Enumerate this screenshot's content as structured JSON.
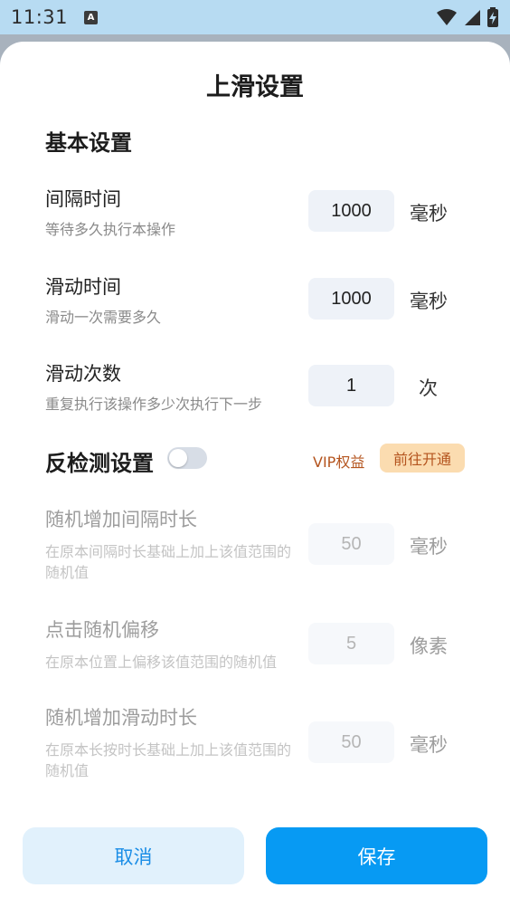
{
  "status_bar": {
    "time": "11:31",
    "notification_icon_letter": "A"
  },
  "sheet": {
    "title": "上滑设置"
  },
  "basic_section": {
    "title": "基本设置",
    "rows": [
      {
        "label": "间隔时间",
        "desc": "等待多久执行本操作",
        "value": "1000",
        "unit": "毫秒"
      },
      {
        "label": "滑动时间",
        "desc": "滑动一次需要多久",
        "value": "1000",
        "unit": "毫秒"
      },
      {
        "label": "滑动次数",
        "desc": "重复执行该操作多少次执行下一步",
        "value": "1",
        "unit": "次"
      }
    ]
  },
  "anti_detect_section": {
    "title": "反检测设置",
    "toggle_on": false,
    "vip_label": "VIP权益",
    "vip_button": "前往开通",
    "rows": [
      {
        "label": "随机增加间隔时长",
        "desc": "在原本间隔时长基础上加上该值范围的随机值",
        "value": "50",
        "unit": "毫秒"
      },
      {
        "label": "点击随机偏移",
        "desc": "在原本位置上偏移该值范围的随机值",
        "value": "5",
        "unit": "像素"
      },
      {
        "label": "随机增加滑动时长",
        "desc": "在原本长按时长基础上加上该值范围的随机值",
        "value": "50",
        "unit": "毫秒"
      }
    ]
  },
  "footer": {
    "cancel_label": "取消",
    "save_label": "保存"
  },
  "colors": {
    "status_bar_bg": "#b7dbf2",
    "primary": "#079af3",
    "cancel_bg": "#e1f1fc",
    "vip_text": "#b4541e",
    "vip_bg": "#fbdcb0"
  }
}
